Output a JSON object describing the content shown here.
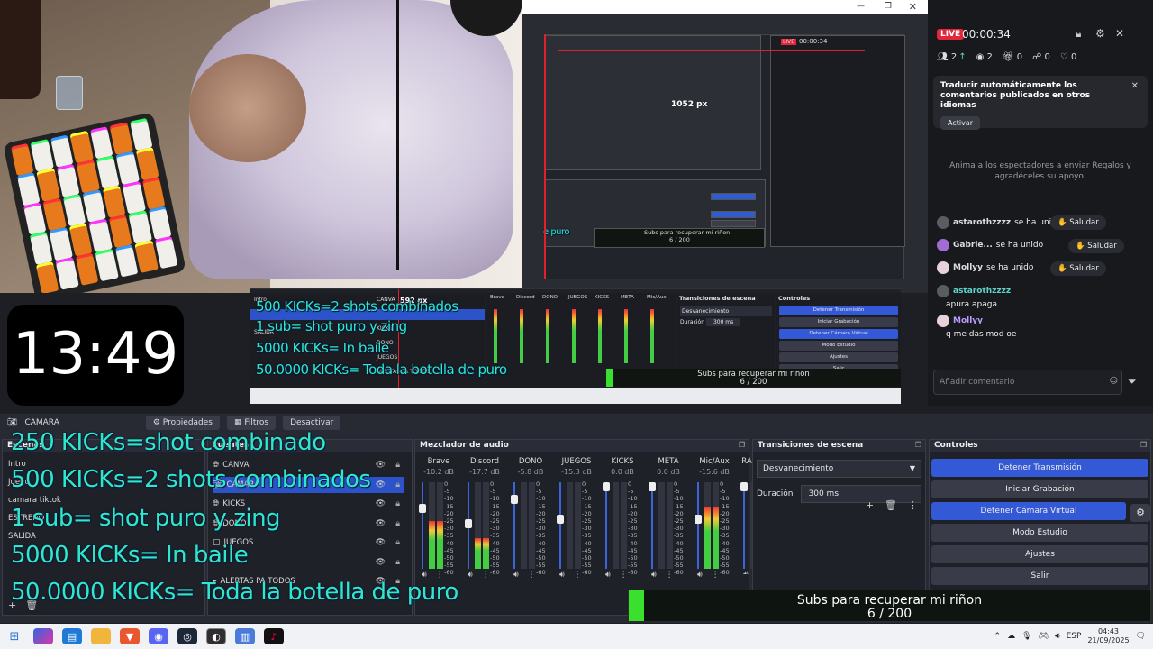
{
  "timer_card": "13:49",
  "chat": {
    "live_label": "LIVE",
    "stream_time": "00:00:34",
    "stats": [
      {
        "icon": "users-icon",
        "value": "2",
        "extra": "↑"
      },
      {
        "icon": "eye-icon",
        "value": "2"
      },
      {
        "icon": "gift-icon",
        "value": "0"
      },
      {
        "icon": "share-icon",
        "value": "0"
      },
      {
        "icon": "heart-icon",
        "value": "0"
      }
    ],
    "banner_title": "Traducir automáticamente los comentarios publicados en otros idiomas",
    "banner_action": "Activar",
    "encourage": "Anima a los espectadores a enviar Regalos y agradéceles su apoyo.",
    "messages": [
      {
        "user": "astarothzzzz",
        "text": "se ha unido",
        "button": "Saludar"
      },
      {
        "user": "Gabrie...",
        "text": "se ha unido",
        "button": "Saludar"
      },
      {
        "user": "Mollyy",
        "text": "se ha unido",
        "button": "Saludar"
      },
      {
        "user": "astarothzzzz",
        "text": "apura apaga"
      },
      {
        "user": "Mollyy",
        "text": "q me das mod oe"
      }
    ],
    "input_placeholder": "Añadir comentario"
  },
  "nested": {
    "px_label": "1052 px",
    "mini_live": "00:00:34",
    "mini_subs": "Subs para recuperar mi riñon",
    "mini_count": "6 / 200",
    "mini_overlay": "e puro"
  },
  "mid": {
    "px_label": "592 px",
    "scenes": [
      "Intro",
      "camara tiktok",
      "SALIDA"
    ],
    "sources": [
      "CANVA",
      "CAMARA",
      "KICKS",
      "DONO",
      "JUEGOS",
      "ALERTAS PA TODOS"
    ],
    "channels": [
      "Brave",
      "Discord",
      "DONO",
      "JUEGOS",
      "KICKS",
      "META",
      "Mic/Aux"
    ],
    "transitions_title": "Transiciones de escena",
    "transition": "Desvanecimiento",
    "duration_label": "Duración",
    "duration": "300 ms",
    "controls_title": "Controles",
    "controls": [
      "Detener Transmisión",
      "Iniciar Grabación",
      "Detener Cámara Virtual",
      "Modo Estudio",
      "Ajustes",
      "Salir"
    ],
    "subs_title": "Subs para recuperar mi riñon",
    "subs_count": "6 / 200",
    "overlays": [
      "500 KICKs=2 shots combinados",
      "1 sub= shot puro y zing",
      "5000 KICKs= In baile",
      "50.0000 KICKs= Toda la botella de puro"
    ]
  },
  "obs": {
    "source_label": "CAMARA",
    "toolbar": {
      "properties": "Propiedades",
      "filters": "Filtros",
      "deactivate": "Desactivar"
    },
    "scenes_title": "Escenas",
    "scenes": [
      "Intro",
      "Juego",
      "camara tiktok",
      "ESTRENO",
      "SALIDA"
    ],
    "sources_title": "Fuentes",
    "sources": [
      "CANVA",
      "CAMARA",
      "KICKS",
      "DONO",
      "JUEGOS",
      "",
      "ALERTAS PA TODOS"
    ],
    "mixer_title": "Mezclador de audio",
    "channels": [
      {
        "name": "Brave",
        "db": "-10.2 dB",
        "level": 0.55
      },
      {
        "name": "Discord",
        "db": "-17.7 dB",
        "level": 0.35
      },
      {
        "name": "DONO",
        "db": "-5.8 dB",
        "level": 0.0
      },
      {
        "name": "JUEGOS",
        "db": "-15.3 dB",
        "level": 0.0
      },
      {
        "name": "KICKS",
        "db": "0.0 dB",
        "level": 0.0
      },
      {
        "name": "META",
        "db": "0.0 dB",
        "level": 0.0
      },
      {
        "name": "Mic/Aux",
        "db": "-15.6 dB",
        "level": 0.72
      },
      {
        "name": "RA",
        "db": "",
        "level": 0.0
      }
    ],
    "meter_scale": [
      "0",
      "-5",
      "-10",
      "-15",
      "-20",
      "-25",
      "-30",
      "-35",
      "-40",
      "-45",
      "-50",
      "-55",
      "-60"
    ],
    "transitions_title": "Transiciones de escena",
    "transition": "Desvanecimiento",
    "duration_label": "Duración",
    "duration": "300 ms",
    "controls_title": "Controles",
    "controls": [
      "Detener Transmisión",
      "Iniciar Grabación",
      "Detener Cámara Virtual",
      "Modo Estudio",
      "Ajustes",
      "Salir"
    ]
  },
  "subs": {
    "title": "Subs para recuperar mi riñon",
    "count": "6 / 200",
    "progress": 0.03
  },
  "overlays": [
    "250 KICKs=shot combinado",
    "500 KICKs=2 shots combinados",
    "1 sub= shot puro y zing",
    "5000 KICKs= In baile",
    "50.0000 KICKs= Toda la botella de puro"
  ],
  "taskbar": {
    "lang": "ESP",
    "time": "04:43",
    "date": "21/09/2025"
  },
  "colors": {
    "accent_blue": "#3459d6",
    "live_red": "#e3263b",
    "overlay_teal": "#2ee8c8",
    "progress_green": "#39e02e"
  }
}
